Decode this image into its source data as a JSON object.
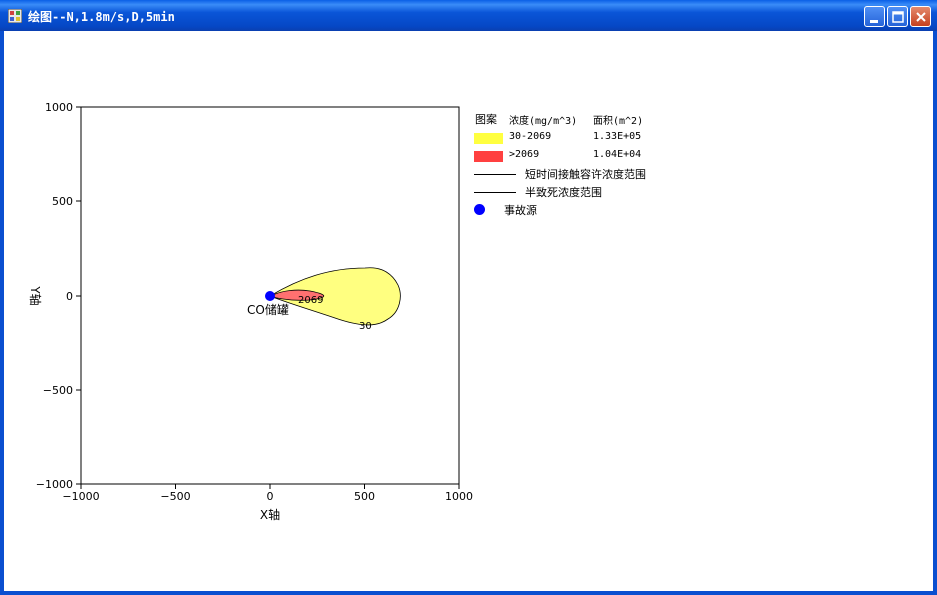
{
  "window": {
    "title": "绘图--N,1.8m/s,D,5min",
    "buttons": {
      "minimize": "minimize",
      "maximize": "maximize",
      "close": "close"
    }
  },
  "plot": {
    "xlabel": "X轴",
    "ylabel": "Y轴",
    "x_ticks": [
      "−1000",
      "−500",
      "0",
      "500",
      "1000"
    ],
    "y_ticks": [
      "1000",
      "500",
      "0",
      "−500",
      "−1000"
    ],
    "xlim": [
      -1000,
      1000
    ],
    "ylim": [
      -1000,
      1000
    ],
    "source_label": "CO储罐",
    "contour_labels": {
      "inner": "2069",
      "outer": "30"
    },
    "colors": {
      "outer_fill": "#ffff80",
      "inner_fill": "#ff7070",
      "source": "#0000ff"
    }
  },
  "legend": {
    "headers": {
      "pattern": "图案",
      "concentration": "浓度(mg/m^3)",
      "area": "面积(m^2)"
    },
    "rows": [
      {
        "range": "30-2069",
        "area": "1.33E+05",
        "color": "#ffff40"
      },
      {
        "range": ">2069",
        "area": "1.04E+04",
        "color": "#ff4040"
      }
    ],
    "short_term_label": "短时间接触容许浓度范围",
    "half_lethal_label": "半致死浓度范围",
    "source_label": "事故源"
  }
}
